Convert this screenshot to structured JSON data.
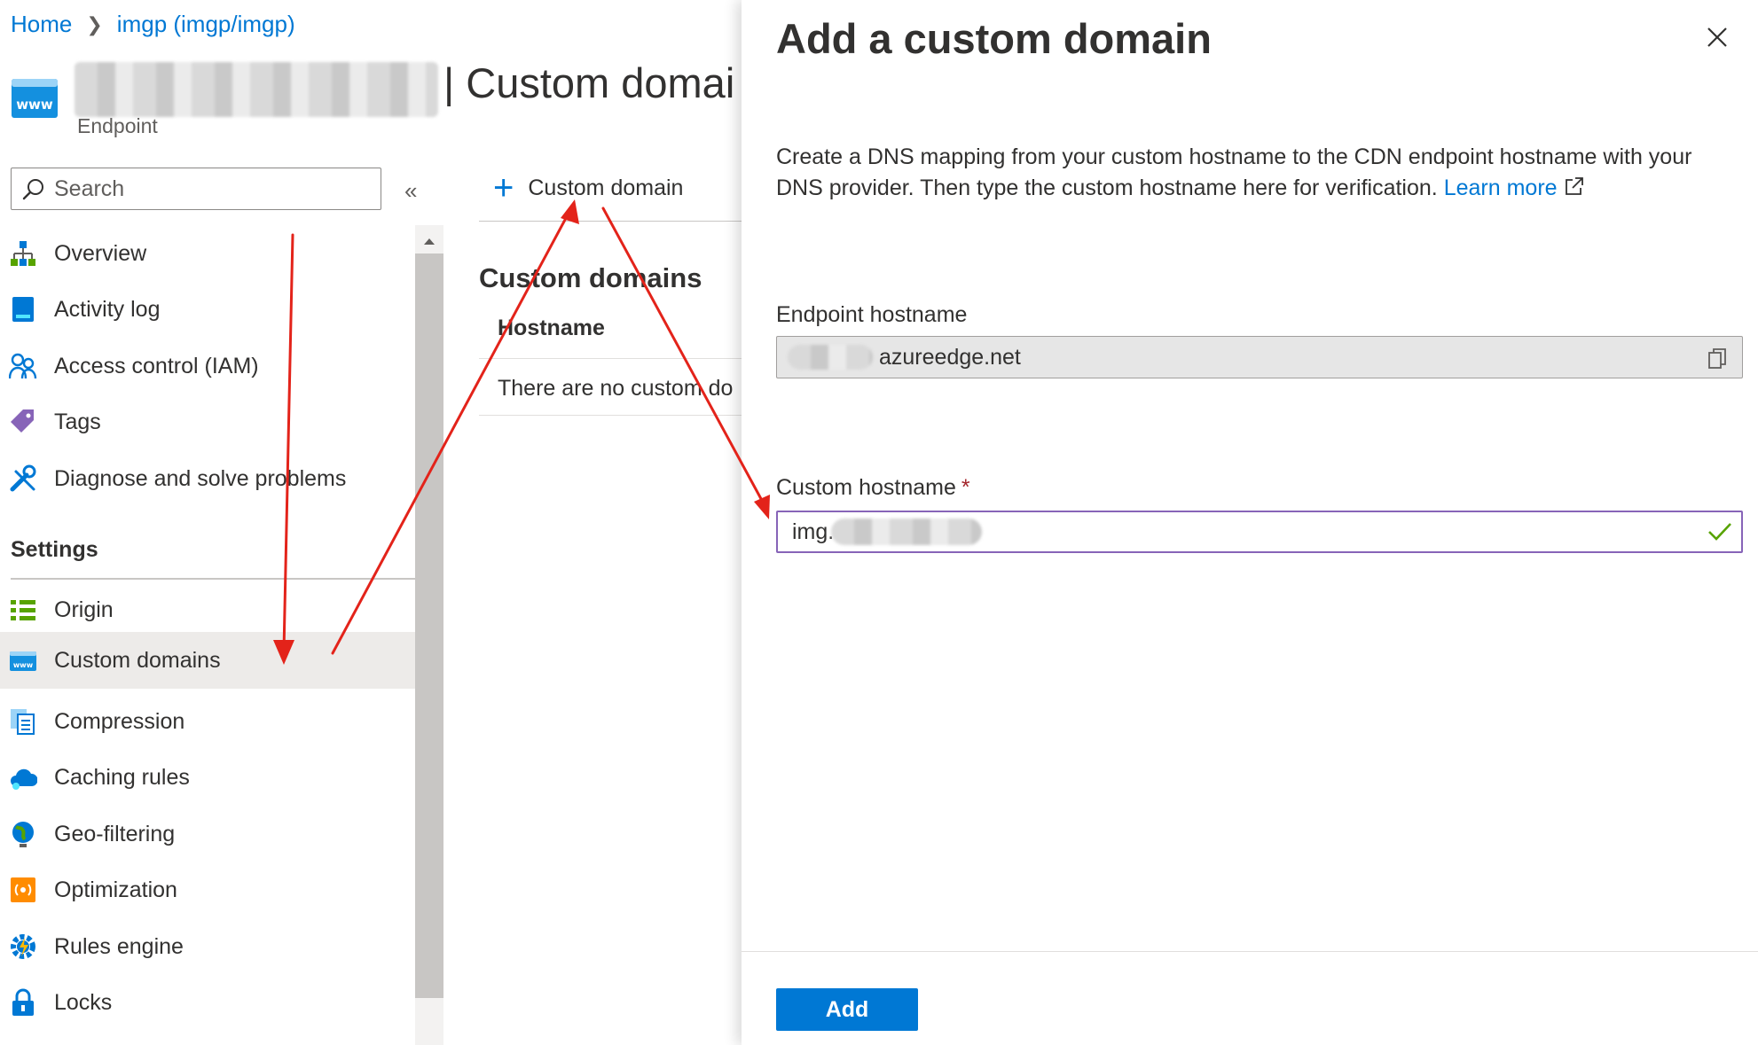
{
  "breadcrumb": {
    "home": "Home",
    "resource": "imgp (imgp/imgp)"
  },
  "header": {
    "title": "| Custom domai",
    "resource_type": "Endpoint",
    "icon": "www-icon"
  },
  "search": {
    "placeholder": "Search",
    "collapse_label": "«"
  },
  "nav": {
    "items": [
      {
        "label": "Overview",
        "icon": "overview-icon"
      },
      {
        "label": "Activity log",
        "icon": "activity-log-icon"
      },
      {
        "label": "Access control (IAM)",
        "icon": "iam-icon"
      },
      {
        "label": "Tags",
        "icon": "tag-icon"
      },
      {
        "label": "Diagnose and solve problems",
        "icon": "wrench-icon"
      }
    ],
    "settings_header": "Settings",
    "settings_items": [
      {
        "label": "Origin",
        "icon": "origin-icon"
      },
      {
        "label": "Custom domains",
        "icon": "www-icon",
        "active": true
      },
      {
        "label": "Compression",
        "icon": "compression-icon"
      },
      {
        "label": "Caching rules",
        "icon": "cloud-icon"
      },
      {
        "label": "Geo-filtering",
        "icon": "globe-icon"
      },
      {
        "label": "Optimization",
        "icon": "optimization-icon"
      },
      {
        "label": "Rules engine",
        "icon": "rules-engine-icon"
      },
      {
        "label": "Locks",
        "icon": "lock-icon"
      }
    ]
  },
  "main": {
    "add_button": "Custom domain",
    "section_title": "Custom domains",
    "column_header": "Hostname",
    "empty_message": "There are no custom do"
  },
  "panel": {
    "title": "Add a custom domain",
    "description": "Create a DNS mapping from your custom hostname to the CDN endpoint hostname with your DNS provider. Then type the custom hostname here for verification.",
    "learn_more": "Learn more",
    "endpoint_label": "Endpoint hostname",
    "endpoint_value": "azureedge.net",
    "custom_label": "Custom hostname",
    "required_mark": "*",
    "custom_value": "img.",
    "add_button": "Add"
  },
  "colors": {
    "accent": "#0078d4",
    "active_input_border": "#8764b8",
    "annotation_red": "#e3231a",
    "required_red": "#a4262c",
    "valid_green": "#57a300"
  }
}
